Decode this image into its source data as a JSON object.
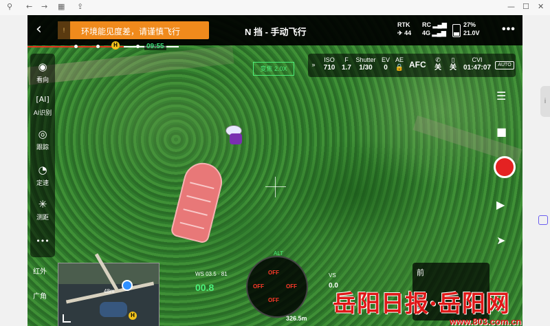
{
  "browser": {
    "icons": [
      "pin-icon",
      "back-icon",
      "forward-icon",
      "tabs-icon",
      "share-icon"
    ],
    "controls": [
      "—",
      "☐",
      "✕"
    ]
  },
  "topbar": {
    "back_label": "‹",
    "warning_text": "环境能见度差，请谨慎飞行",
    "mode_title": "N 挡 - 手动飞行",
    "rtk_label": "RTK",
    "rtk_value": "44",
    "rc_label": "RC",
    "rc_sub": "4G",
    "battery_percent": "27%",
    "battery_voltage": "21.0V",
    "more_label": "•••"
  },
  "flight_progress": {
    "time_remaining": "09:55",
    "home_marker": "H"
  },
  "left_tools": [
    {
      "name": "view",
      "icon": "eye-icon",
      "glyph": "◉",
      "label": "看向"
    },
    {
      "name": "ai",
      "icon": "ai-icon",
      "glyph": "[AI]",
      "label": "AI识别"
    },
    {
      "name": "track",
      "icon": "target-icon",
      "glyph": "◎",
      "label": "跟踪"
    },
    {
      "name": "speed",
      "icon": "gauge-icon",
      "glyph": "◔",
      "label": "定速"
    },
    {
      "name": "range",
      "icon": "laser-icon",
      "glyph": "✳",
      "label": "测距"
    },
    {
      "name": "more",
      "icon": "more-icon",
      "glyph": "•••",
      "label": ""
    }
  ],
  "lens_labels": {
    "infrared": "红外",
    "wide": "广角"
  },
  "camera": {
    "iso_label": "ISO",
    "iso": "710",
    "f_label": "F",
    "f": "1.7",
    "shutter_label": "Shutter",
    "shutter": "1/30",
    "ev_label": "EV",
    "ev": "0",
    "ae_label": "AE",
    "afc": "AFC",
    "off1": "关",
    "off2": "关",
    "mode_label": "CVI",
    "record_time": "01:47:07",
    "auto_label": "AUTO"
  },
  "green_box": "变焦 2.0X",
  "map": {
    "distance": "48m",
    "home": "H"
  },
  "telemetry": {
    "ws": "WS 03.5 · 81",
    "speed": "00.8",
    "vs_label": "VS",
    "vs_value": "0.0",
    "distance": "326.5m",
    "alt": "ALT",
    "off_labels": [
      "OFF",
      "OFF",
      "OFF",
      "OFF"
    ]
  },
  "lens_switch": {
    "front": "前",
    "swap": "⇄"
  },
  "watermark": {
    "text": "岳阳日报·岳阳网",
    "url": "www.803.com.cn"
  },
  "colors": {
    "warning": "#f08a1c",
    "record": "#e42222",
    "accent_green": "#4df07a",
    "watermark": "#e01818"
  }
}
